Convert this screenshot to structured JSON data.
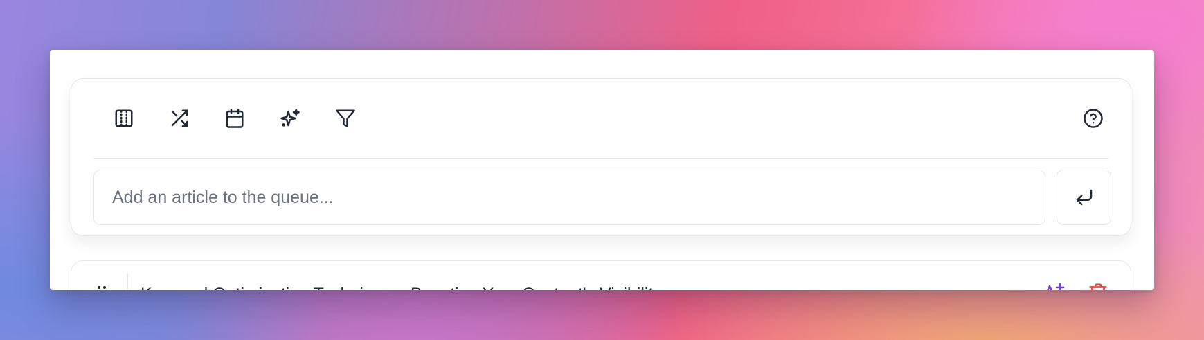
{
  "toolbar": {
    "icons": {
      "columns": "table-columns-icon",
      "shuffle": "shuffle-icon",
      "calendar": "calendar-icon",
      "sparkles": "sparkles-icon",
      "filter": "filter-icon",
      "help": "help-circle-icon"
    }
  },
  "queue_input": {
    "placeholder": "Add an article to the queue...",
    "value": "",
    "submit_icon": "enter-icon"
  },
  "articles": [
    {
      "title": "Keyword Optimization Techniques: Boosting Your Content's Visibility",
      "actions": {
        "ai_rewrite_icon": "ai-text-icon",
        "delete_icon": "trash-icon"
      }
    }
  ],
  "colors": {
    "accent": "#7c3aed",
    "danger": "#ef4444",
    "border": "#e5e7eb",
    "icon": "#1f2937"
  }
}
